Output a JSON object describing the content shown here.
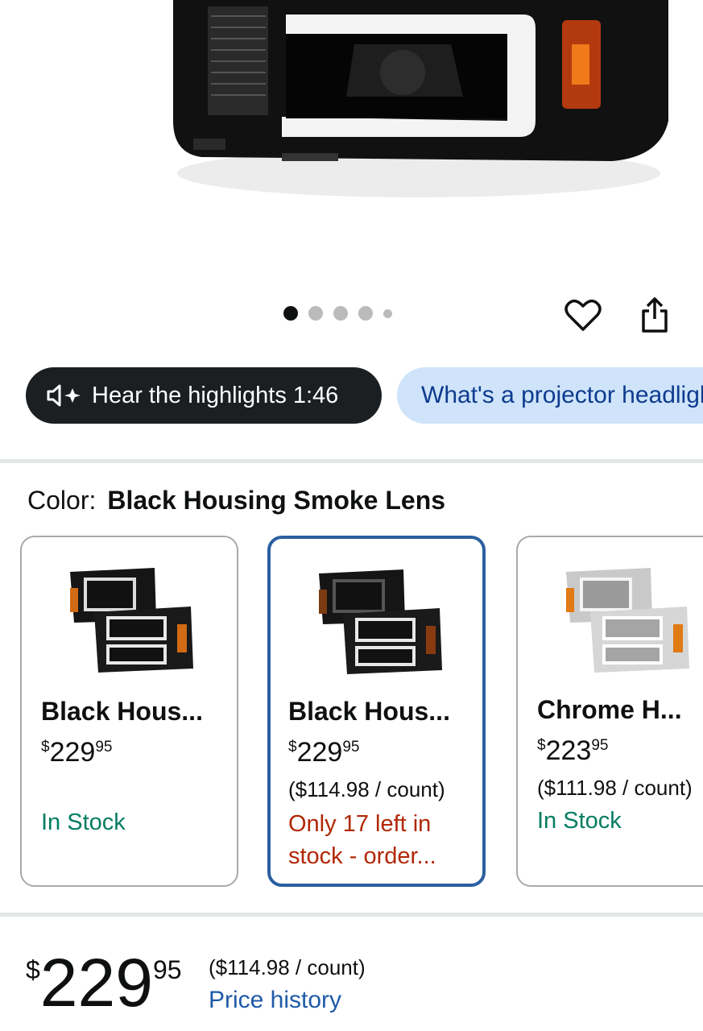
{
  "carousel": {
    "count": 5,
    "active_index": 0
  },
  "actions": {
    "favorite_icon": "heart-icon",
    "share_icon": "share-icon"
  },
  "highlights": {
    "icon": "speaker-sparkle-icon",
    "label": "Hear the highlights 1:46"
  },
  "question_chip": {
    "label": "What's a projector headlight?"
  },
  "color": {
    "label": "Color:",
    "value": "Black Housing Smoke Lens"
  },
  "swatches": [
    {
      "name": "Black Hous...",
      "currency": "$",
      "whole": "229",
      "fraction": "95",
      "unit_price": "",
      "stock": "In Stock",
      "stock_status": "in_stock",
      "selected": false
    },
    {
      "name": "Black Hous...",
      "currency": "$",
      "whole": "229",
      "fraction": "95",
      "unit_price": "($114.98 / count)",
      "stock": "Only 17 left in stock - order...",
      "stock_status": "low_stock",
      "selected": true
    },
    {
      "name": "Chrome H...",
      "currency": "$",
      "whole": "223",
      "fraction": "95",
      "unit_price": "($111.98 / count)",
      "stock": "In Stock",
      "stock_status": "in_stock",
      "selected": false
    }
  ],
  "price": {
    "currency": "$",
    "whole": "229",
    "fraction": "95",
    "unit_price": "($114.98 / count)",
    "history_link": "Price history"
  },
  "colors": {
    "accent_blue": "#2b5fa0",
    "in_stock": "#067d62",
    "low_stock": "#b12704",
    "chip_bg": "#cfe4fa",
    "link": "#1f5aa8"
  }
}
